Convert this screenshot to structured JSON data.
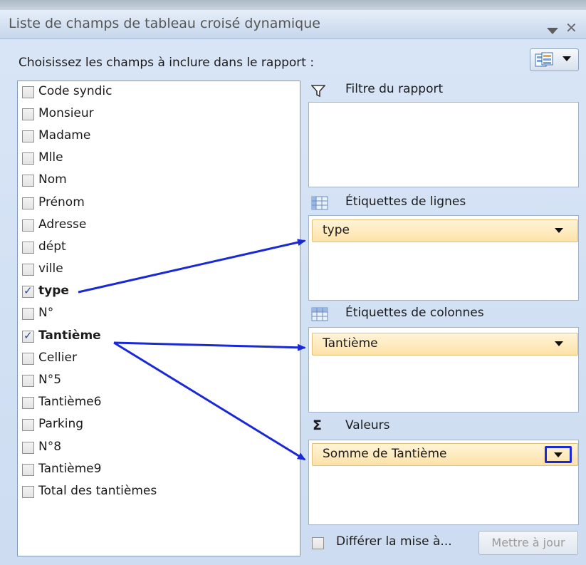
{
  "pane": {
    "title": "Liste de champs de tableau croisé dynamique",
    "instruction": "Choisissez les champs à inclure dans le rapport :"
  },
  "fields": [
    {
      "label": "Code syndic",
      "checked": false
    },
    {
      "label": "Monsieur",
      "checked": false
    },
    {
      "label": "Madame",
      "checked": false
    },
    {
      "label": "Mlle",
      "checked": false
    },
    {
      "label": "Nom",
      "checked": false
    },
    {
      "label": "Prénom",
      "checked": false
    },
    {
      "label": "Adresse",
      "checked": false
    },
    {
      "label": "dépt",
      "checked": false
    },
    {
      "label": "ville",
      "checked": false
    },
    {
      "label": "type",
      "checked": true
    },
    {
      "label": "N°",
      "checked": false
    },
    {
      "label": "Tantième",
      "checked": true
    },
    {
      "label": "Cellier",
      "checked": false
    },
    {
      "label": "N°5",
      "checked": false
    },
    {
      "label": "Tantième6",
      "checked": false
    },
    {
      "label": "Parking",
      "checked": false
    },
    {
      "label": "N°8",
      "checked": false
    },
    {
      "label": "Tantième9",
      "checked": false
    },
    {
      "label": "Total des tantièmes",
      "checked": false
    }
  ],
  "areas": {
    "filter": {
      "label": "Filtre du rapport"
    },
    "rows": {
      "label": "Étiquettes de lignes",
      "item": "type"
    },
    "columns": {
      "label": "Étiquettes de colonnes",
      "item": "Tantième"
    },
    "values": {
      "label": "Valeurs",
      "item": "Somme de Tantième",
      "symbol": "Σ"
    }
  },
  "footer": {
    "defer_label": "Différer la mise à...",
    "update_label": "Mettre à jour"
  },
  "colors": {
    "arrow": "#1a29d6",
    "chip_border": "#e2c27a",
    "pane_bg": "#d9e6f7"
  },
  "icons": {
    "filter": "funnel-icon",
    "rows": "row-grid-icon",
    "columns": "column-grid-icon",
    "values": "sigma-icon",
    "layout": "field-layout-icon"
  }
}
